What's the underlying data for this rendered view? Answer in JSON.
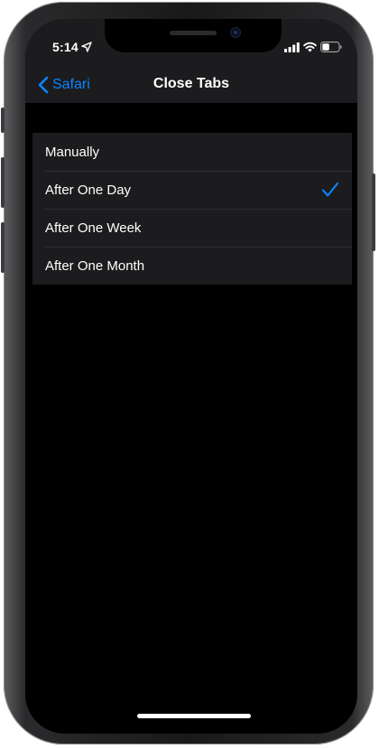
{
  "status_bar": {
    "time": "5:14",
    "icons": [
      "location-arrow-icon",
      "cellular-signal-icon",
      "wifi-icon",
      "battery-icon"
    ]
  },
  "nav": {
    "back_label": "Safari",
    "title": "Close Tabs"
  },
  "options": [
    {
      "label": "Manually",
      "selected": false
    },
    {
      "label": "After One Day",
      "selected": true
    },
    {
      "label": "After One Week",
      "selected": false
    },
    {
      "label": "After One Month",
      "selected": false
    }
  ],
  "colors": {
    "accent": "#0a84ff",
    "grouped_background": "#1c1c1e",
    "background": "#000000"
  }
}
